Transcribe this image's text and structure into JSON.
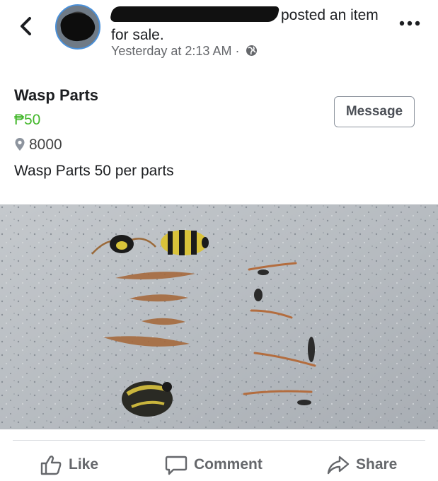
{
  "header": {
    "posted_text": "posted an item for sale.",
    "timestamp": "Yesterday at 2:13 AM",
    "separator": "·",
    "back_icon": "chevron-left-icon",
    "privacy_icon": "globe-icon",
    "more_icon": "more-dots-icon"
  },
  "listing": {
    "title": "Wasp Parts",
    "price": "₱50",
    "location": "8000",
    "description": "Wasp Parts 50 per parts",
    "message_label": "Message",
    "price_color": "#42b72a"
  },
  "actions": {
    "like_label": "Like",
    "comment_label": "Comment",
    "share_label": "Share"
  }
}
